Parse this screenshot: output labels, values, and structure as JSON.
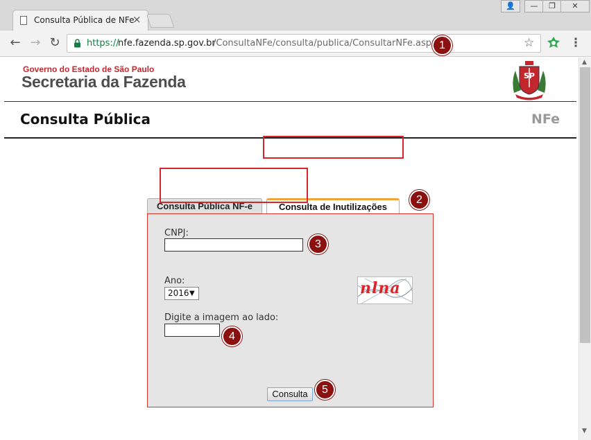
{
  "browser": {
    "tab_title": "Consulta Pública de NFe",
    "tab_close": "×",
    "url_scheme": "https://",
    "url_host": "nfe.fazenda.sp.gov.br",
    "url_path": "/ConsultaNFe/consulta/publica/ConsultarNFe.aspx",
    "window_user": "👤",
    "window_min": "—",
    "window_max": "❐",
    "window_close": "✕",
    "back": "←",
    "forward": "→",
    "reload": "↻",
    "star": "☆",
    "menu": "⋮"
  },
  "header": {
    "gov_line": "Governo do Estado de São Paulo",
    "secretaria": "Secretaria da Fazenda",
    "crest_letters": "SP"
  },
  "page": {
    "title": "Consulta Pública",
    "right_label": "NFe"
  },
  "tabs": [
    {
      "label": "Consulta Pública NF-e",
      "active": false
    },
    {
      "label": "Consulta de Inutilizações",
      "active": true
    }
  ],
  "form": {
    "cnpj_label": "CNPJ:",
    "cnpj_value": "",
    "ano_label": "Ano:",
    "ano_selected": "2016",
    "ano_arrow": "▼",
    "captcha_text": "nlna",
    "captcha_label": "Digite a imagem ao lado:",
    "captcha_value": "",
    "submit_label": "Consulta"
  },
  "annotations": {
    "markers": [
      "1",
      "2",
      "3",
      "4",
      "5"
    ],
    "highlight_color": "#d5262d",
    "marker_color": "#8b1010"
  },
  "colors": {
    "secure_green": "#0b8043",
    "brand_red": "#c1272d",
    "tab_accent": "#f0a53b"
  },
  "scrollbar": {
    "up": "▲",
    "down": "▼"
  }
}
